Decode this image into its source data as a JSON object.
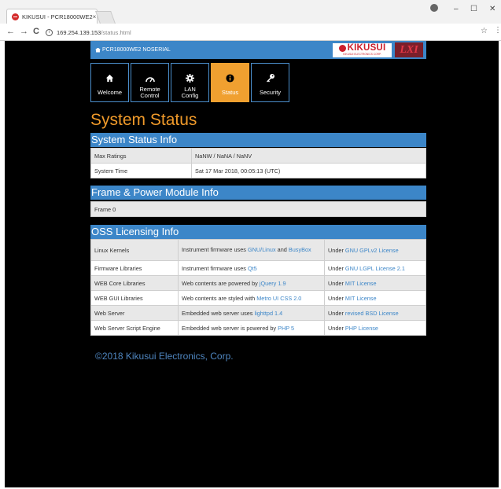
{
  "browser": {
    "tab_title": "KIKUSUI - PCR18000WE2",
    "tab_close": "×",
    "url_host": "169.254.139.153",
    "url_path": "/status.html",
    "back": "←",
    "forward": "→",
    "reload": "C",
    "bookmark": "☆",
    "menu": "⋮",
    "minimize": "–",
    "maximize": "☐",
    "close": "✕"
  },
  "header": {
    "instrument": "PCR18000WE2 NOSERIAL",
    "logo_text": "KIKUSUI",
    "logo_subtext": "KIKUSUI ELECTRONICS CORP.",
    "lxi_text": "LXI"
  },
  "nav": [
    {
      "label1": "Welcome",
      "label2": "",
      "icon": "home-icon"
    },
    {
      "label1": "Remote",
      "label2": "Control",
      "icon": "gauge-icon"
    },
    {
      "label1": "LAN",
      "label2": "Config",
      "icon": "gear-icon"
    },
    {
      "label1": "Status",
      "label2": "",
      "icon": "info-icon",
      "active": true
    },
    {
      "label1": "Security",
      "label2": "",
      "icon": "key-icon"
    }
  ],
  "page_title": "System Status",
  "system_status": {
    "heading": "System Status Info",
    "rows": [
      {
        "label": "Max Ratings",
        "value": "NaNW / NaNA / NaNV"
      },
      {
        "label": "System Time",
        "value": "Sat 17 Mar 2018, 00:05:13 (UTC)"
      }
    ]
  },
  "frame_power": {
    "heading": "Frame & Power Module Info",
    "rows": [
      {
        "label": "Frame 0"
      }
    ]
  },
  "oss": {
    "heading": "OSS Licensing Info",
    "rows": [
      {
        "label": "Linux Kernels",
        "desc_pre": "Instrument firmware uses ",
        "desc_link": "GNU/Linux",
        "desc_mid": " and ",
        "desc_link2": "BusyBox",
        "lic_pre": "Under ",
        "lic_link": "GNU GPLv2 License"
      },
      {
        "label": "Firmware Libraries",
        "desc_pre": "Instrument firmware uses ",
        "desc_link": "Qt5",
        "lic_pre": "Under ",
        "lic_link": "GNU LGPL License 2.1"
      },
      {
        "label": "WEB Core Libraries",
        "desc_pre": "Web contents are powered by ",
        "desc_link": "jQuery 1.9",
        "lic_pre": "Under ",
        "lic_link": "MIT License"
      },
      {
        "label": "WEB GUI Libraries",
        "desc_pre": "Web contents are styled with ",
        "desc_link": "Metro UI CSS 2.0",
        "lic_pre": "Under ",
        "lic_link": "MIT License"
      },
      {
        "label": "Web Server",
        "desc_pre": "Embedded web server uses ",
        "desc_link": "lighttpd 1.4",
        "lic_pre": "Under ",
        "lic_link": "revised BSD License"
      },
      {
        "label": "Web Server Script Engine",
        "desc_pre": "Embedded web server is powered by ",
        "desc_link": "PHP 5",
        "lic_pre": "Under ",
        "lic_link": "PHP License"
      }
    ]
  },
  "footer": "©2018 Kikusui Electronics, Corp.",
  "colors": {
    "accent_blue": "#3c86c8",
    "active_orange": "#f0a030",
    "title_orange": "#f09a2a",
    "background": "#000000"
  }
}
